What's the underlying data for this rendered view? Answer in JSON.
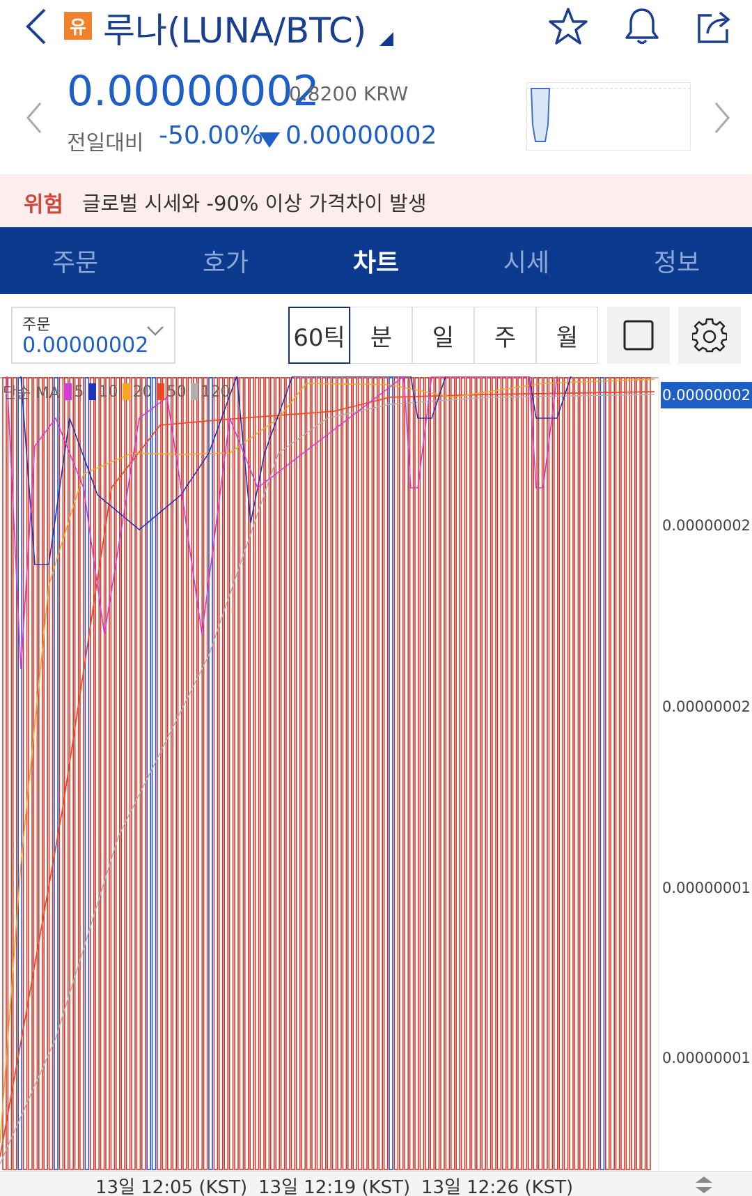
{
  "header": {
    "badge": "유",
    "title": "루나(LUNA/BTC)",
    "icons": [
      "star-icon",
      "bell-icon",
      "share-icon"
    ]
  },
  "price": {
    "current": "0.00000002",
    "krw": "0.8200 KRW",
    "change_label": "전일대비",
    "change_pct": "-50.00%",
    "change_amount": "0.00000002"
  },
  "warning": {
    "tag": "위험",
    "text": "글로벌 시세와 -90% 이상 가격차이 발생"
  },
  "tabs": [
    {
      "label": "주문",
      "active": false
    },
    {
      "label": "호가",
      "active": false
    },
    {
      "label": "차트",
      "active": true
    },
    {
      "label": "시세",
      "active": false
    },
    {
      "label": "정보",
      "active": false
    }
  ],
  "toolbar": {
    "order_label": "주문",
    "order_value": "0.00000002",
    "intervals": [
      "60틱",
      "분",
      "일",
      "주",
      "월"
    ],
    "active_interval": "60틱"
  },
  "chart": {
    "legend_prefix": "단순 MA",
    "ma": [
      {
        "label": "5",
        "color": "#d63bd6"
      },
      {
        "label": "10",
        "color": "#2233bb"
      },
      {
        "label": "20",
        "color": "#f5a623"
      },
      {
        "label": "50",
        "color": "#f04a24"
      },
      {
        "label": "120",
        "color": "#b0b0b0"
      }
    ],
    "current_price_tag": "0.00000002",
    "y_labels": [
      "0.00000002",
      "0.00000002",
      "0.00000001",
      "0.00000001"
    ],
    "x_labels": [
      "13일 12:05 (KST)",
      "13일 12:19 (KST)",
      "13일 12:26 (KST)"
    ],
    "colors": {
      "up": "#d13b2e",
      "down": "#2a54c8"
    }
  }
}
